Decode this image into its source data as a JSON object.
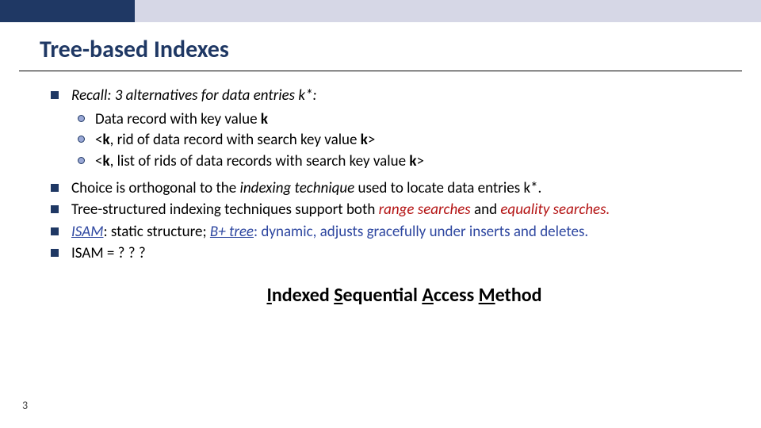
{
  "title": "Tree-based Indexes",
  "bullets": {
    "b1": {
      "pre": "Recall: 3 alternatives for data entries ",
      "k": "k*",
      "post": ":"
    },
    "sub": {
      "s1": {
        "pre": "Data record with key value ",
        "k": "k"
      },
      "s2": {
        "pre": "<",
        "k1": "k",
        "mid": ", rid of data record with search key value ",
        "k2": "k",
        "post": ">"
      },
      "s3": {
        "pre": "<",
        "k1": "k",
        "mid": ", list of rids of data records with search key value ",
        "k2": "k",
        "post": ">"
      }
    },
    "b2": {
      "pre": "Choice is orthogonal to the ",
      "em": "indexing technique",
      "post": " used to locate data entries k*."
    },
    "b3": {
      "pre": "Tree-structured indexing techniques support both ",
      "rs": "range searches",
      "mid": " and ",
      "es": "equality searches",
      "post": "."
    },
    "b4": {
      "isam": "ISAM",
      "mid1": ":  static structure;  ",
      "bpt": "B+ tree",
      "mid2": ":  dynamic, adjusts gracefully under inserts and deletes."
    },
    "b5": "ISAM = ? ? ?"
  },
  "isam": {
    "i": "I",
    "ndexed": "ndexed ",
    "s": "S",
    "equential": "equential ",
    "a": "A",
    "ccess": "ccess ",
    "m": "M",
    "ethod": "ethod"
  },
  "page_number": "3"
}
